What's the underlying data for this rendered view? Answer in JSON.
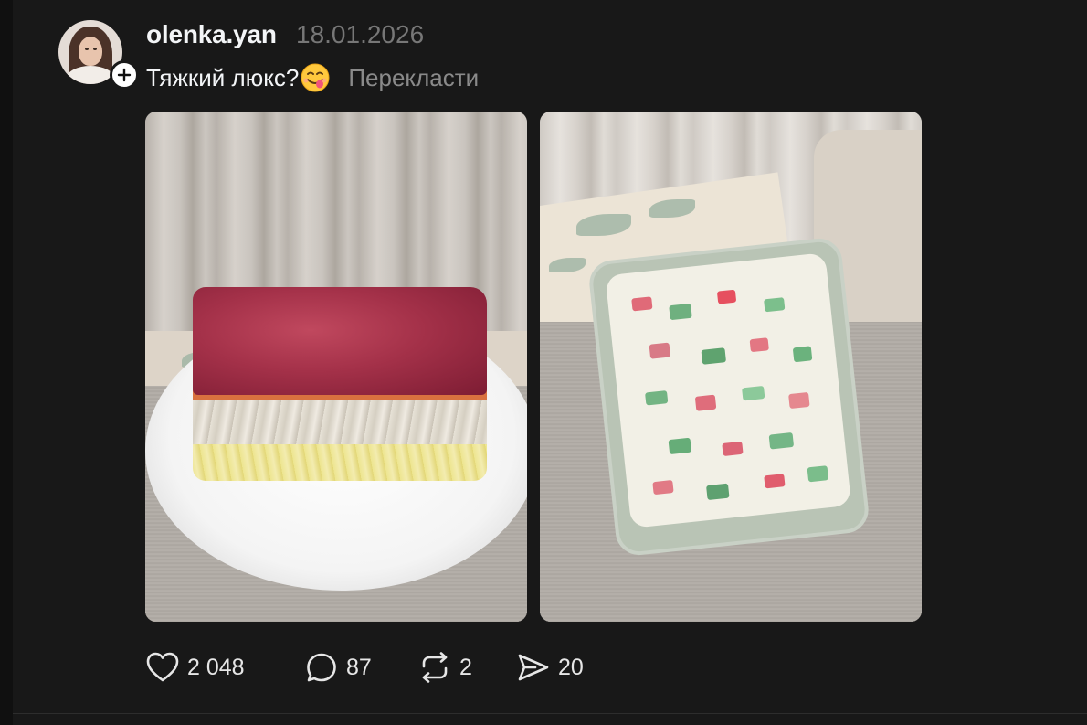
{
  "post": {
    "author": {
      "username": "olenka.yan",
      "avatar_icon": "profile-photo",
      "follow_icon": "plus-icon"
    },
    "date": "18.01.2026",
    "caption": "Тяжкий люкс?",
    "caption_emoji": "savoring-food-face",
    "translate_label": "Перекласти",
    "media": [
      {
        "description_icon": "layered-salad-photo"
      },
      {
        "description_icon": "jelly-salad-photo"
      }
    ],
    "actions": {
      "like": {
        "icon": "heart-icon",
        "count": "2 048"
      },
      "reply": {
        "icon": "comment-icon",
        "count": "87"
      },
      "repost": {
        "icon": "repost-icon",
        "count": "2"
      },
      "share": {
        "icon": "send-icon",
        "count": "20"
      }
    }
  },
  "colors": {
    "background": "#101010",
    "surface": "#181818",
    "text_primary": "#f3f5f7",
    "text_secondary": "#777777"
  }
}
